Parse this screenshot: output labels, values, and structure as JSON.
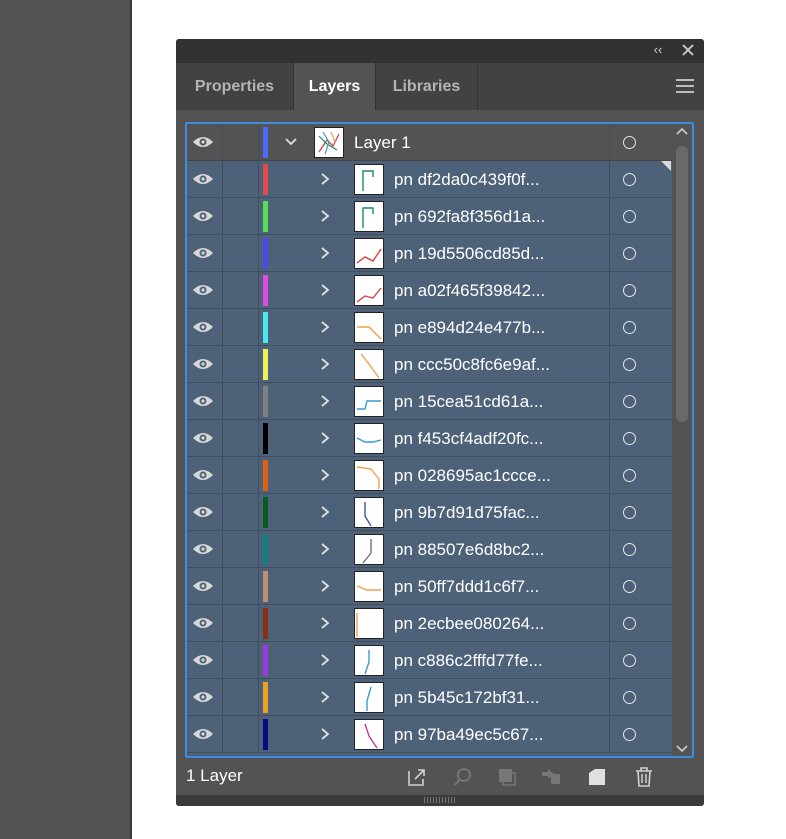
{
  "panel": {
    "collapse_glyph": "‹‹",
    "tabs": [
      {
        "label": "Properties",
        "active": false
      },
      {
        "label": "Layers",
        "active": true
      },
      {
        "label": "Libraries",
        "active": false
      }
    ]
  },
  "layers": {
    "top": {
      "name": "Layer 1",
      "color": "#4b6bff"
    },
    "items": [
      {
        "name": "pn df2da0c439f0f...",
        "color": "#e24a4a",
        "thumb_color": "#1a8a6a"
      },
      {
        "name": "pn 692fa8f356d1a...",
        "color": "#55e055",
        "thumb_color": "#1a8a6a"
      },
      {
        "name": "pn 19d5506cd85d...",
        "color": "#4a4ae8",
        "thumb_color": "#d84040"
      },
      {
        "name": "pn a02f465f39842...",
        "color": "#e24ae0",
        "thumb_color": "#d84040"
      },
      {
        "name": "pn e894d24e477b...",
        "color": "#4ae8e8",
        "thumb_color": "#f0a050"
      },
      {
        "name": "pn ccc50c8fc6e9af...",
        "color": "#f0f05a",
        "thumb_color": "#f0a050"
      },
      {
        "name": "pn 15cea51cd61a...",
        "color": "#808080",
        "thumb_color": "#3a9ad0"
      },
      {
        "name": "pn f453cf4adf20fc...",
        "color": "#000000",
        "thumb_color": "#3a9ad0"
      },
      {
        "name": "pn 028695ac1ccce...",
        "color": "#e06010",
        "thumb_color": "#f0a050"
      },
      {
        "name": "pn 9b7d91d75fac...",
        "color": "#0a5a1a",
        "thumb_color": "#3a5a9a"
      },
      {
        "name": "pn 88507e6d8bc2...",
        "color": "#108080",
        "thumb_color": "#707070"
      },
      {
        "name": "pn 50ff7ddd1c6f7...",
        "color": "#c09070",
        "thumb_color": "#f0a050"
      },
      {
        "name": "pn 2ecbee080264...",
        "color": "#8a3010",
        "thumb_color": "#f0a050"
      },
      {
        "name": "pn c886c2fffd77fe...",
        "color": "#9a3ae0",
        "thumb_color": "#3a9ad0"
      },
      {
        "name": "pn 5b45c172bf31...",
        "color": "#f0a020",
        "thumb_color": "#3a9ad0"
      },
      {
        "name": "pn 97ba49ec5c67...",
        "color": "#0a0a80",
        "thumb_color": "#c03a9a"
      }
    ]
  },
  "footer": {
    "count_label": "1 Layer"
  }
}
